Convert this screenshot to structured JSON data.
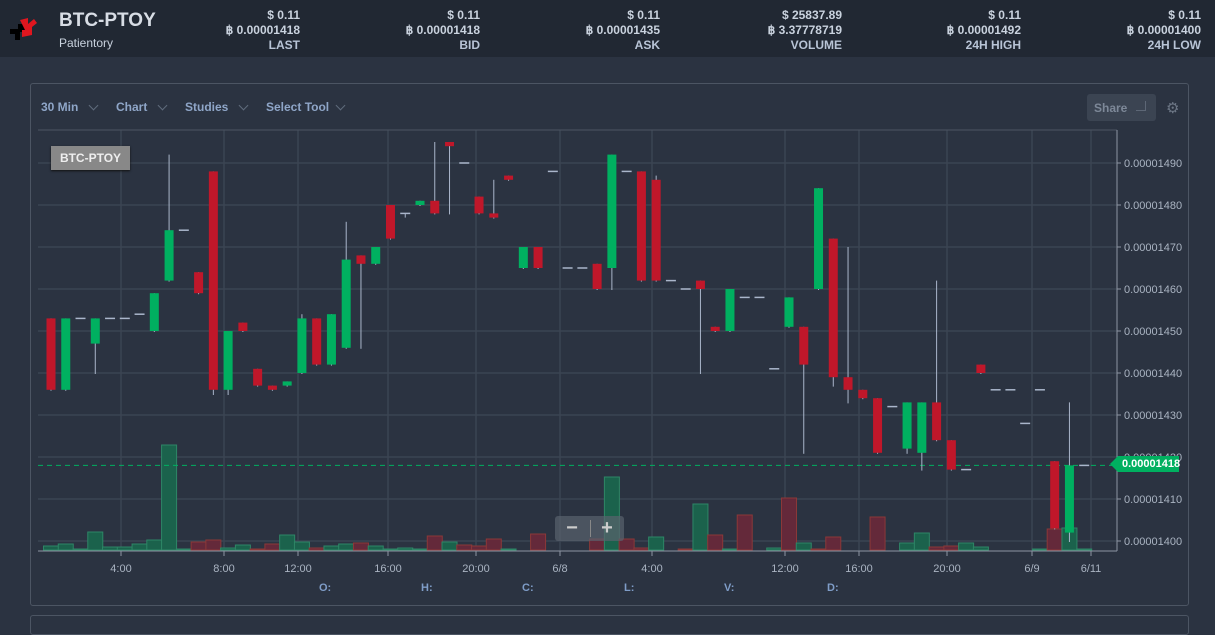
{
  "header": {
    "pair": "BTC-PTOY",
    "name": "Patientory",
    "stats": [
      {
        "usd": "$ 0.11",
        "btc": "฿ 0.00001418",
        "label": "LAST"
      },
      {
        "usd": "$ 0.11",
        "btc": "฿ 0.00001418",
        "label": "BID"
      },
      {
        "usd": "$ 0.11",
        "btc": "฿ 0.00001435",
        "label": "ASK"
      },
      {
        "usd": "$ 25837.89",
        "btc": "฿ 3.37778719",
        "label": "VOLUME"
      },
      {
        "usd": "$ 0.11",
        "btc": "฿ 0.00001492",
        "label": "24H HIGH"
      },
      {
        "usd": "$ 0.11",
        "btc": "฿ 0.00001400",
        "label": "24H LOW"
      }
    ]
  },
  "toolbar": {
    "interval": "30 Min",
    "chart": "Chart",
    "studies": "Studies",
    "tool": "Select Tool",
    "share": "Share",
    "icons": [
      "chevron-down-icon",
      "share-icon",
      "gear-icon"
    ]
  },
  "zoom_control": {
    "minus": "−",
    "plus": "+"
  },
  "ohlc_labels": [
    "O:",
    "H:",
    "C:",
    "L:",
    "V:",
    "D:"
  ],
  "chart_data": {
    "type": "candlestick",
    "symbol_label": "BTC-PTOY",
    "last_price": "0.00001418",
    "colors": {
      "up": "#00b060",
      "down": "#c0172a",
      "last_line": "#00b060"
    },
    "y_ticks": [
      "0.00001400",
      "0.00001410",
      "0.00001420",
      "0.00001430",
      "0.00001440",
      "0.00001450",
      "0.00001460",
      "0.00001470",
      "0.00001480",
      "0.00001490"
    ],
    "x_ticks": [
      "4:00",
      "8:00",
      "12:00",
      "16:00",
      "20:00",
      "6/8",
      "4:00",
      "12:00",
      "16:00",
      "20:00",
      "6/9",
      "6/11"
    ],
    "grid": true,
    "ohlc": [
      [
        1.453e-05,
        1.453e-05,
        1.436e-05,
        1.436e-05
      ],
      [
        1.436e-05,
        1.453e-05,
        1.436e-05,
        1.453e-05
      ],
      [
        1.453e-05,
        1.453e-05,
        1.453e-05,
        1.453e-05
      ],
      [
        1.447e-05,
        1.453e-05,
        1.44e-05,
        1.453e-05
      ],
      [
        1.453e-05,
        1.453e-05,
        1.453e-05,
        1.453e-05
      ],
      [
        1.453e-05,
        1.453e-05,
        1.453e-05,
        1.453e-05
      ],
      [
        1.454e-05,
        1.454e-05,
        1.454e-05,
        1.454e-05
      ],
      [
        1.45e-05,
        1.459e-05,
        1.45e-05,
        1.459e-05
      ],
      [
        1.462e-05,
        1.492e-05,
        1.462e-05,
        1.474e-05
      ],
      [
        1.474e-05,
        1.474e-05,
        1.474e-05,
        1.474e-05
      ],
      [
        1.464e-05,
        1.464e-05,
        1.459e-05,
        1.459e-05
      ],
      [
        1.488e-05,
        1.488e-05,
        1.435e-05,
        1.436e-05
      ],
      [
        1.436e-05,
        1.45e-05,
        1.435e-05,
        1.45e-05
      ],
      [
        1.452e-05,
        1.452e-05,
        1.45e-05,
        1.45e-05
      ],
      [
        1.441e-05,
        1.441e-05,
        1.437e-05,
        1.437e-05
      ],
      [
        1.437e-05,
        1.437e-05,
        1.436e-05,
        1.436e-05
      ],
      [
        1.437e-05,
        1.438e-05,
        1.437e-05,
        1.438e-05
      ],
      [
        1.44e-05,
        1.454e-05,
        1.44e-05,
        1.453e-05
      ],
      [
        1.453e-05,
        1.453e-05,
        1.442e-05,
        1.442e-05
      ],
      [
        1.442e-05,
        1.454e-05,
        1.442e-05,
        1.454e-05
      ],
      [
        1.446e-05,
        1.476e-05,
        1.446e-05,
        1.467e-05
      ],
      [
        1.468e-05,
        1.468e-05,
        1.446e-05,
        1.466e-05
      ],
      [
        1.466e-05,
        1.47e-05,
        1.466e-05,
        1.47e-05
      ],
      [
        1.48e-05,
        1.48e-05,
        1.472e-05,
        1.472e-05
      ],
      [
        1.478e-05,
        1.478e-05,
        1.477e-05,
        1.478e-05
      ],
      [
        1.48e-05,
        1.481e-05,
        1.48e-05,
        1.481e-05
      ],
      [
        1.481e-05,
        1.495e-05,
        1.478e-05,
        1.478e-05
      ],
      [
        1.495e-05,
        1.495e-05,
        1.478e-05,
        1.494e-05
      ],
      [
        1.49e-05,
        1.49e-05,
        1.49e-05,
        1.49e-05
      ],
      [
        1.482e-05,
        1.482e-05,
        1.478e-05,
        1.478e-05
      ],
      [
        1.478e-05,
        1.486e-05,
        1.477e-05,
        1.477e-05
      ],
      [
        1.487e-05,
        1.487e-05,
        1.486e-05,
        1.486e-05
      ],
      [
        1.465e-05,
        1.47e-05,
        1.465e-05,
        1.47e-05
      ],
      [
        1.47e-05,
        1.47e-05,
        1.465e-05,
        1.465e-05
      ],
      [
        1.488e-05,
        1.488e-05,
        1.488e-05,
        1.488e-05
      ],
      [
        1.465e-05,
        1.465e-05,
        1.465e-05,
        1.465e-05
      ],
      [
        1.465e-05,
        1.465e-05,
        1.465e-05,
        1.465e-05
      ],
      [
        1.466e-05,
        1.466e-05,
        1.46e-05,
        1.46e-05
      ],
      [
        1.465e-05,
        1.492e-05,
        1.46e-05,
        1.492e-05
      ],
      [
        1.488e-05,
        1.488e-05,
        1.488e-05,
        1.488e-05
      ],
      [
        1.488e-05,
        1.488e-05,
        1.462e-05,
        1.462e-05
      ],
      [
        1.486e-05,
        1.487e-05,
        1.462e-05,
        1.462e-05
      ],
      [
        1.462e-05,
        1.462e-05,
        1.462e-05,
        1.462e-05
      ],
      [
        1.46e-05,
        1.46e-05,
        1.46e-05,
        1.46e-05
      ],
      [
        1.462e-05,
        1.462e-05,
        1.44e-05,
        1.46e-05
      ],
      [
        1.451e-05,
        1.451e-05,
        1.45e-05,
        1.45e-05
      ],
      [
        1.45e-05,
        1.46e-05,
        1.45e-05,
        1.46e-05
      ],
      [
        1.458e-05,
        1.458e-05,
        1.458e-05,
        1.458e-05
      ],
      [
        1.458e-05,
        1.458e-05,
        1.458e-05,
        1.458e-05
      ],
      [
        1.441e-05,
        1.441e-05,
        1.441e-05,
        1.441e-05
      ],
      [
        1.451e-05,
        1.458e-05,
        1.451e-05,
        1.458e-05
      ],
      [
        1.451e-05,
        1.451e-05,
        1.421e-05,
        1.442e-05
      ],
      [
        1.46e-05,
        1.484e-05,
        1.46e-05,
        1.484e-05
      ],
      [
        1.472e-05,
        1.472e-05,
        1.437e-05,
        1.439e-05
      ],
      [
        1.439e-05,
        1.47e-05,
        1.433e-05,
        1.436e-05
      ],
      [
        1.436e-05,
        1.436e-05,
        1.434e-05,
        1.434e-05
      ],
      [
        1.434e-05,
        1.434e-05,
        1.421e-05,
        1.421e-05
      ],
      [
        1.432e-05,
        1.432e-05,
        1.432e-05,
        1.432e-05
      ],
      [
        1.422e-05,
        1.433e-05,
        1.421e-05,
        1.433e-05
      ],
      [
        1.421e-05,
        1.433e-05,
        1.417e-05,
        1.433e-05
      ],
      [
        1.433e-05,
        1.462e-05,
        1.424e-05,
        1.424e-05
      ],
      [
        1.424e-05,
        1.424e-05,
        1.417e-05,
        1.417e-05
      ],
      [
        1.417e-05,
        1.417e-05,
        1.417e-05,
        1.417e-05
      ],
      [
        1.442e-05,
        1.442e-05,
        1.44e-05,
        1.44e-05
      ],
      [
        1.436e-05,
        1.436e-05,
        1.436e-05,
        1.436e-05
      ],
      [
        1.436e-05,
        1.436e-05,
        1.436e-05,
        1.436e-05
      ],
      [
        1.428e-05,
        1.428e-05,
        1.428e-05,
        1.428e-05
      ],
      [
        1.436e-05,
        1.436e-05,
        1.436e-05,
        1.436e-05
      ],
      [
        1.419e-05,
        1.419e-05,
        1.403e-05,
        1.403e-05
      ],
      [
        1.402e-05,
        1.433e-05,
        1.4e-05,
        1.418e-05
      ],
      [
        1.418e-05,
        1.418e-05,
        1.418e-05,
        1.418e-05
      ]
    ],
    "volume_relative": [
      [
        4,
        "up"
      ],
      [
        6,
        "up"
      ],
      [
        1,
        "up"
      ],
      [
        18,
        "up"
      ],
      [
        3,
        "up"
      ],
      [
        3,
        "up"
      ],
      [
        6,
        "up"
      ],
      [
        10,
        "up"
      ],
      [
        105,
        "up"
      ],
      [
        1,
        "up"
      ],
      [
        8,
        "down"
      ],
      [
        10,
        "down"
      ],
      [
        2,
        "up"
      ],
      [
        5,
        "up"
      ],
      [
        1,
        "down"
      ],
      [
        6,
        "down"
      ],
      [
        15,
        "up"
      ],
      [
        8,
        "up"
      ],
      [
        2,
        "down"
      ],
      [
        4,
        "up"
      ],
      [
        6,
        "up"
      ],
      [
        7,
        "down"
      ],
      [
        4,
        "up"
      ],
      [
        1,
        "up"
      ],
      [
        2,
        "up"
      ],
      [
        1,
        "up"
      ],
      [
        14,
        "down"
      ],
      [
        8,
        "up"
      ],
      [
        5,
        "down"
      ],
      [
        4,
        "down"
      ],
      [
        11,
        "down"
      ],
      [
        1,
        "up"
      ],
      [
        0,
        "up"
      ],
      [
        16,
        "down"
      ],
      [
        0,
        "up"
      ],
      [
        0,
        "up"
      ],
      [
        0,
        "up"
      ],
      [
        11,
        "down"
      ],
      [
        73,
        "up"
      ],
      [
        11,
        "down"
      ],
      [
        2,
        "down"
      ],
      [
        13,
        "up"
      ],
      [
        0,
        "up"
      ],
      [
        1,
        "down"
      ],
      [
        46,
        "up"
      ],
      [
        15,
        "down"
      ],
      [
        1,
        "up"
      ],
      [
        35,
        "down"
      ],
      [
        0,
        "up"
      ],
      [
        2,
        "up"
      ],
      [
        52,
        "down"
      ],
      [
        7,
        "up"
      ],
      [
        1,
        "down"
      ],
      [
        13,
        "down"
      ],
      [
        0,
        "up"
      ],
      [
        0,
        "up"
      ],
      [
        33,
        "down"
      ],
      [
        0,
        "up"
      ],
      [
        7,
        "up"
      ],
      [
        17,
        "up"
      ],
      [
        3,
        "down"
      ],
      [
        4,
        "down"
      ],
      [
        7,
        "up"
      ],
      [
        3,
        "up"
      ],
      [
        0,
        "up"
      ],
      [
        0,
        "up"
      ],
      [
        0,
        "up"
      ],
      [
        1,
        "up"
      ],
      [
        21,
        "down"
      ],
      [
        22,
        "up"
      ],
      [
        1,
        "up"
      ]
    ]
  }
}
